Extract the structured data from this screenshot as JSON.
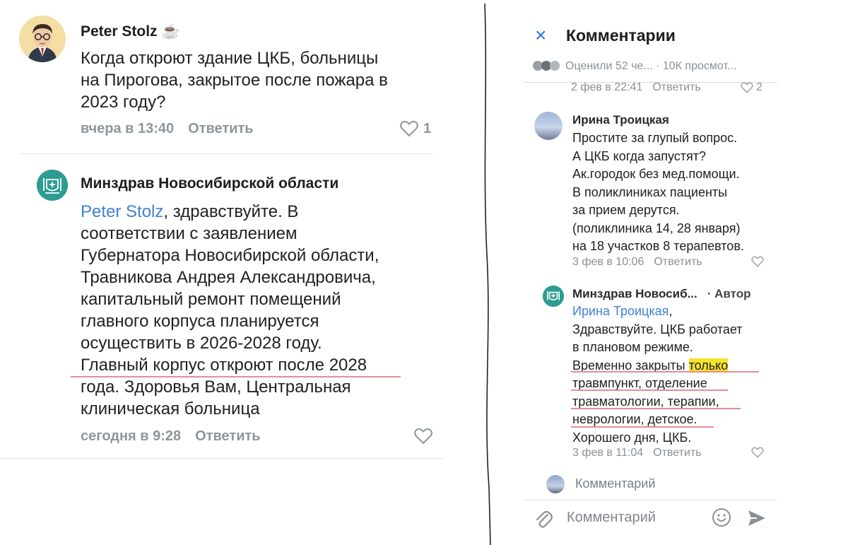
{
  "left": {
    "comment1": {
      "author": "Peter Stolz",
      "author_emoji": "☕",
      "text": "Когда откроют здание ЦКБ, больницы\nна Пирогова, закрытое после пожара в\n2023 году?",
      "time": "вчера в 13:40",
      "reply": "Ответить",
      "likes": "1"
    },
    "comment2": {
      "author": "Минздрав Новосибирской области",
      "mention": "Peter Stolz",
      "text_after_mention": ", здравствуйте. В\nсоответствии с заявлением\nГубернатора Новосибирской области,\nТравникова Андрея Александровича,\nкапитальный ремонт помещений\nглавного корпуса планируется\nосуществить в 2026-2028 году.\nГлавный корпус откроют после 2028\nгода. Здоровья Вам, Центральная\nклиническая больница",
      "time": "сегодня в 9:28",
      "reply": "Ответить"
    }
  },
  "right": {
    "title": "Комментарии",
    "close_icon": "×",
    "stats": "Оценили 52 че... · 10К просмот...",
    "prev_meta": {
      "time": "2 фев в 22:41",
      "reply": "Ответить",
      "likes": "2"
    },
    "comment1": {
      "author": "Ирина Троицкая",
      "text": "Простите за глупый вопрос.\nА ЦКБ когда запустят?\nАк.городок без мед.помощи.\nВ поликлиниках пациенты\nза прием дерутся.\n(поликлиника 14, 28 января)\nна 18 участков 8 терапевтов.",
      "time": "3 фев в 10:06",
      "reply": "Ответить"
    },
    "comment2": {
      "author": "Минздрав Новосиб...",
      "author_tag": "· Автор",
      "mention": "Ирина Троицкая",
      "line1": ",",
      "line2": "Здравствуйте. ЦКБ работает",
      "line3": "в плановом режиме.",
      "line4a": "Временно закрыты ",
      "line4b": "только",
      "line5": "травмпункт, отделение",
      "line6": "травматологии, терапии,",
      "line7": "неврологии, детское.",
      "line8": "Хорошего дня, ЦКБ.",
      "time": "3 фев в 11:04",
      "reply": "Ответить"
    },
    "comment_prompt": "Комментарий",
    "input_placeholder": "Комментарий"
  },
  "colors": {
    "link": "#3f83d2",
    "highlight": "#f5e32c",
    "underline": "#e58e93",
    "accent": "#2a6fd6",
    "gov_avatar": "#2e9c92"
  }
}
